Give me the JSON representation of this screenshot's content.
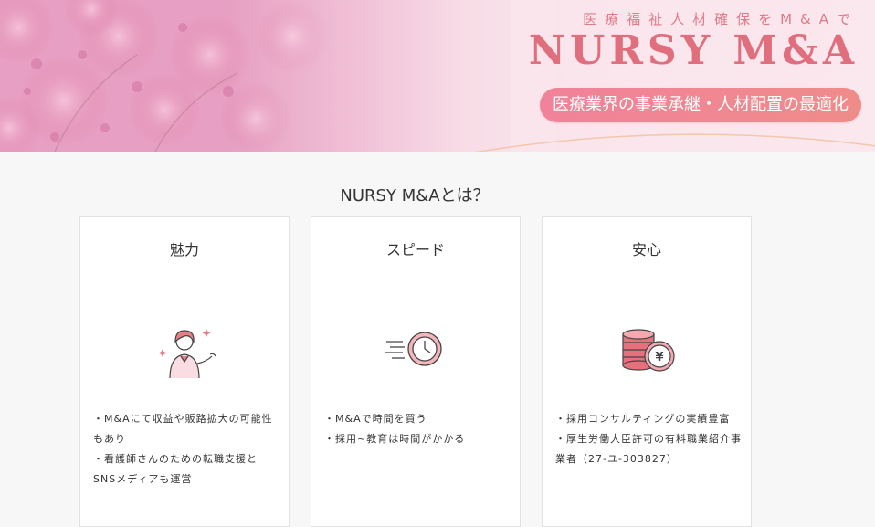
{
  "hero": {
    "tagline": "医療福祉人材確保をM&Aで",
    "logo": "NURSY M&A",
    "subtitle": "医療業界の事業承継・人材配置の最適化",
    "colors": {
      "accent": "#e06e7c",
      "pill": "#f0829a"
    }
  },
  "section": {
    "title": "NURSY M&Aとは？"
  },
  "cards": [
    {
      "title": "魅力",
      "icon": "woman-presenting-icon",
      "points": [
        "・M&Aにて収益や販路拡大の可能性もあり",
        "・看護師さんのための転職支援とSNSメディアも運営"
      ]
    },
    {
      "title": "スピード",
      "icon": "fast-clock-icon",
      "points": [
        "・M&Aで時間を買う",
        "・採用~教育は時間がかかる"
      ]
    },
    {
      "title": "安心",
      "icon": "yen-coins-icon",
      "points": [
        "・採用コンサルティングの実績豊富",
        "・厚生労働大臣許可の有料職業紹介事業者（27-ユ-303827）"
      ]
    }
  ]
}
